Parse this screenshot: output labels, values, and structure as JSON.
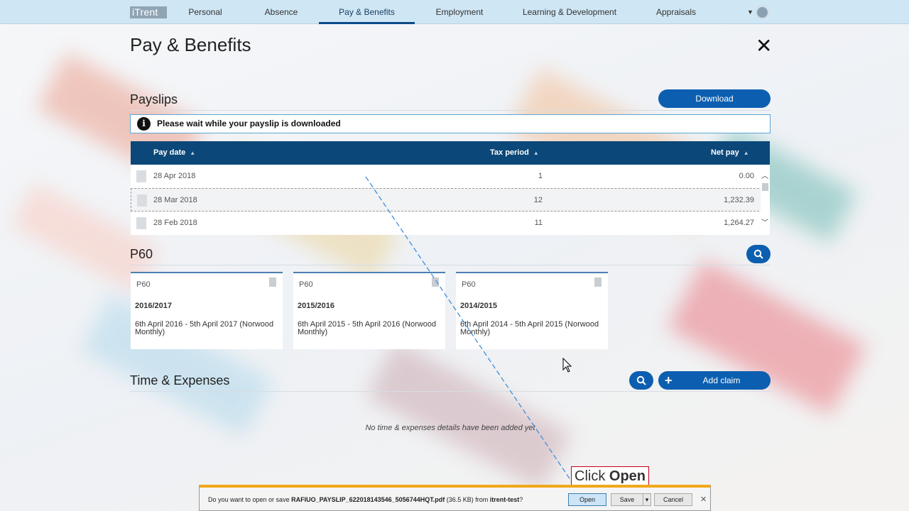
{
  "nav": {
    "logo": "iTrent",
    "items": [
      "Personal",
      "Absence",
      "Pay & Benefits",
      "Employment",
      "Learning & Development",
      "Appraisals"
    ],
    "active": "Pay & Benefits"
  },
  "page": {
    "title": "Pay & Benefits"
  },
  "payslips": {
    "title": "Payslips",
    "download_label": "Download",
    "alert": "Please wait while your payslip is downloaded",
    "columns": [
      "Pay date",
      "Tax period",
      "Net pay"
    ],
    "rows": [
      {
        "date": "28 Apr 2018",
        "period": "1",
        "net": "0.00"
      },
      {
        "date": "28 Mar 2018",
        "period": "12",
        "net": "1,232.39"
      },
      {
        "date": "28 Feb 2018",
        "period": "11",
        "net": "1,264.27"
      }
    ]
  },
  "p60": {
    "title": "P60",
    "cards": [
      {
        "type": "P60",
        "year": "2016/2017",
        "period": "6th April 2016 - 5th April 2017 (Norwood Monthly)"
      },
      {
        "type": "P60",
        "year": "2015/2016",
        "period": "6th April 2015 - 5th April 2016 (Norwood Monthly)"
      },
      {
        "type": "P60",
        "year": "2014/2015",
        "period": "6th April 2014 - 5th April 2015 (Norwood Monthly)"
      }
    ]
  },
  "expenses": {
    "title": "Time & Expenses",
    "add_label": "Add claim",
    "empty": "No time & expenses details have been added yet"
  },
  "download_bar": {
    "prefix": "Do you want to open or save ",
    "filename": "RAFIUO_PAYSLIP_622018143546_5056744HQT.pdf",
    "size": " (36.5 KB) from ",
    "source": "itrent-test",
    "suffix": "?",
    "open": "Open",
    "save": "Save",
    "cancel": "Cancel"
  },
  "callout": {
    "prefix": "Click ",
    "action": "Open"
  },
  "colors": {
    "nav_bg": "#cfe6f4",
    "primary": "#0c5fb0",
    "table_header": "#0b4778",
    "notice_bar": "#f0a81a"
  }
}
